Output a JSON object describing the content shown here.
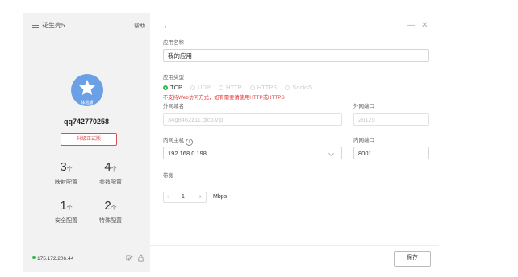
{
  "sidebar": {
    "title": "花生壳5",
    "help": "帮助",
    "avatar_badge": "体验版",
    "username": "qq742770258",
    "upgrade_label": "升级正式版",
    "stats": [
      {
        "num": "3",
        "unit": "个",
        "label": "映射配置"
      },
      {
        "num": "4",
        "unit": "个",
        "label": "参数配置"
      },
      {
        "num": "1",
        "unit": "个",
        "label": "安全配置"
      },
      {
        "num": "2",
        "unit": "个",
        "label": "特殊配置"
      }
    ],
    "ip": "175.172.206.44"
  },
  "main": {
    "back": "←",
    "minimize": "—",
    "close": "✕",
    "app_name_label": "应用名称",
    "app_name_value": "我的应用",
    "app_type_label": "应用类型",
    "types": [
      "TCP",
      "UDP",
      "HTTP",
      "HTTPS",
      "Socks5"
    ],
    "selected_type": "TCP",
    "warning": "不支持Web访问方式，如有需要请使用HTTP或HTTPS",
    "ext_domain_label": "外网域名",
    "ext_domain_value": "34g8462z11.qicp.vip",
    "ext_port_label": "外网端口",
    "ext_port_value": "26125",
    "int_host_label": "内网主机",
    "int_host_value": "192.168.0.198",
    "int_port_label": "内网端口",
    "int_port_value": "8001",
    "bandwidth_label": "带宽",
    "bandwidth_value": "1",
    "bandwidth_unit": "Mbps",
    "save_label": "保存"
  },
  "colors": {
    "accent_red": "#e0403f",
    "selected_green": "#2fb84f",
    "avatar_blue": "#6aa0e6"
  }
}
